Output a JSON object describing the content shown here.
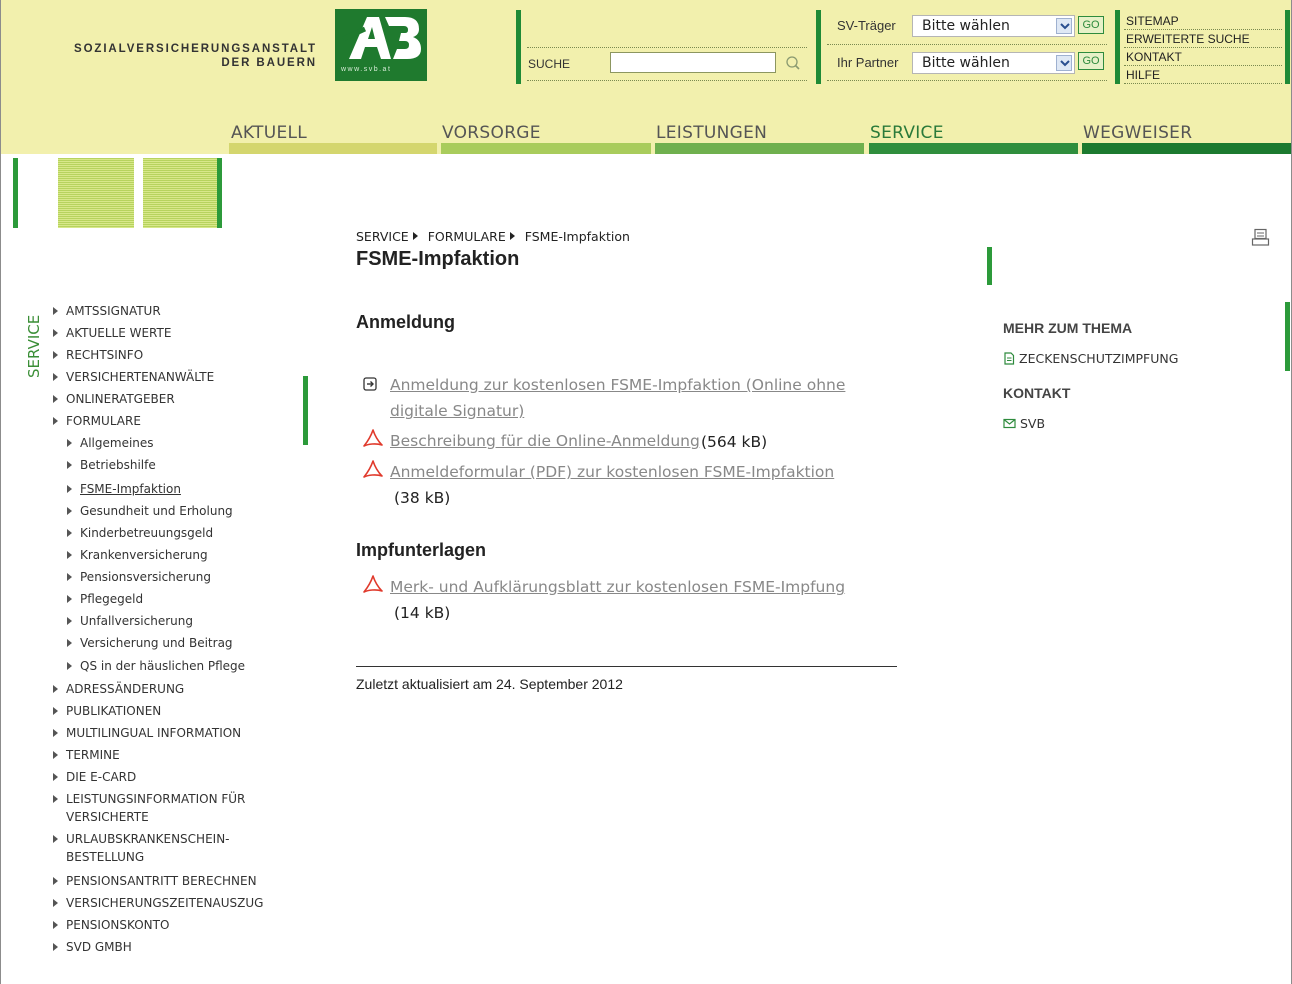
{
  "header": {
    "org_line1": "SOZIALVERSICHERUNGSANSTALT",
    "org_line2": "DER BAUERN",
    "logo_url_text": "www.svb.at",
    "search_label": "SUCHE",
    "search_value": "",
    "sv_traeger_label": "SV-Träger",
    "partner_label": "Ihr Partner",
    "select_value_1": "Bitte wählen",
    "select_value_2": "Bitte wählen",
    "go_label": "GO",
    "top_links": [
      "SITEMAP",
      "ERWEITERTE SUCHE",
      "KONTAKT",
      "HILFE"
    ]
  },
  "nav": [
    {
      "label": "AKTUELL",
      "color": "#d4d66e"
    },
    {
      "label": "VORSORGE",
      "color": "#a9cc5c"
    },
    {
      "label": "LEISTUNGEN",
      "color": "#6fb04e"
    },
    {
      "label": "SERVICE",
      "color": "#2f8e3d"
    },
    {
      "label": "WEGWEISER",
      "color": "#1c7a2f"
    }
  ],
  "sidebar": {
    "section_title": "SERVICE",
    "items": [
      {
        "label": "AMTSSIGNATUR"
      },
      {
        "label": "AKTUELLE WERTE"
      },
      {
        "label": "RECHTSINFO"
      },
      {
        "label": "VERSICHERTENANWÄLTE"
      },
      {
        "label": "ONLINERATGEBER"
      },
      {
        "label": "FORMULARE"
      }
    ],
    "sub_items": [
      {
        "label": "Allgemeines"
      },
      {
        "label": "Betriebshilfe"
      },
      {
        "label": "FSME-Impfaktion"
      },
      {
        "label": "Gesundheit und Erholung"
      },
      {
        "label": "Kinderbetreuungsgeld"
      },
      {
        "label": "Krankenversicherung"
      },
      {
        "label": "Pensionsversicherung"
      },
      {
        "label": "Pflegegeld"
      },
      {
        "label": "Unfallversicherung"
      },
      {
        "label": "Versicherung und Beitrag"
      },
      {
        "label": "QS in der häuslichen Pflege"
      }
    ],
    "items_after": [
      {
        "label": "ADRESSÄNDERUNG"
      },
      {
        "label": "PUBLIKATIONEN"
      },
      {
        "label": "MULTILINGUAL INFORMATION"
      },
      {
        "label": "TERMINE"
      },
      {
        "label": "DIE E-CARD"
      },
      {
        "label": "LEISTUNGSINFORMATION FÜR",
        "label2": "VERSICHERTE"
      },
      {
        "label": "URLAUBSKRANKENSCHEIN-",
        "label2": "BESTELLUNG"
      },
      {
        "label": "PENSIONSANTRITT BERECHNEN"
      },
      {
        "label": "VERSICHERUNGSZEITENAUSZUG"
      },
      {
        "label": "PENSIONSKONTO"
      },
      {
        "label": "SVD GMBH"
      }
    ]
  },
  "breadcrumb": [
    "SERVICE",
    "FORMULARE",
    "FSME-Impfaktion"
  ],
  "page_title": "FSME-Impfaktion",
  "sections": {
    "anmeldung_title": "Anmeldung",
    "link1_line1": "Anmeldung zur kostenlosen FSME-Impfaktion (Online ohne",
    "link1_line2": "digitale Signatur)",
    "link2": "Beschreibung für die Online-Anmeldung ",
    "link2_size": "(564 kB)",
    "link3": "Anmeldeformular (PDF) zur kostenlosen FSME-Impfaktion",
    "link3_size": "(38 kB)",
    "impf_title": "Impfunterlagen",
    "link4": "Merk- und Aufklärungsblatt zur kostenlosen FSME-Impfung",
    "link4_size": "(14 kB)"
  },
  "updated": "Zuletzt aktualisiert am 24. September 2012",
  "right": {
    "mehr_title": "MEHR ZUM THEMA",
    "mehr_link": "ZECKENSCHUTZIMPFUNG",
    "kontakt_title": "KONTAKT",
    "kontakt_link": "SVB"
  },
  "colors": {
    "header_bg": "#f2f0ad",
    "brand_green": "#1f8a36"
  }
}
